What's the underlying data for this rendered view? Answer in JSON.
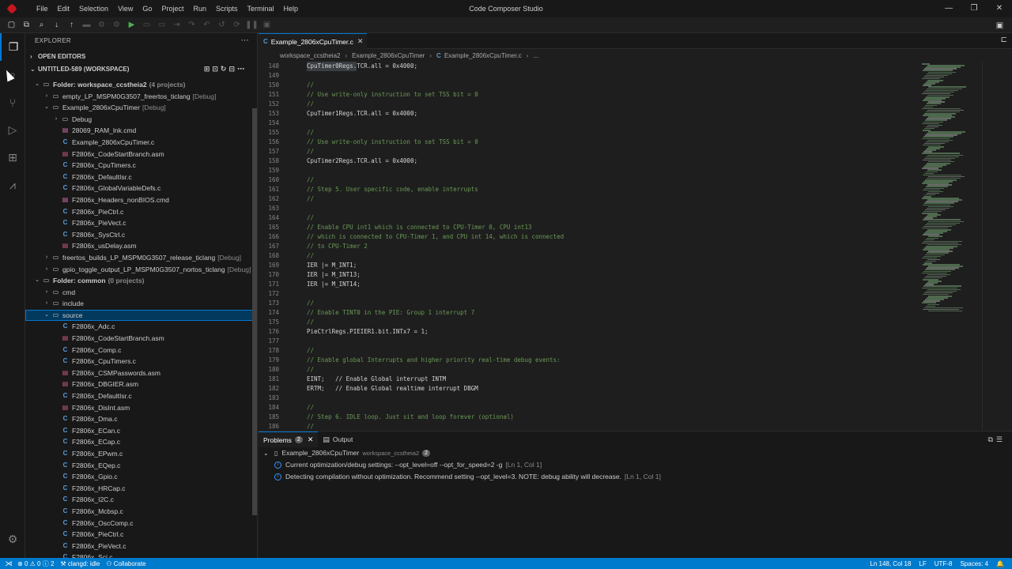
{
  "window": {
    "title": "Code Composer Studio",
    "menu": [
      "File",
      "Edit",
      "Selection",
      "View",
      "Go",
      "Project",
      "Run",
      "Scripts",
      "Terminal",
      "Help"
    ],
    "controls": [
      "—",
      "❐",
      "✕"
    ]
  },
  "explorer": {
    "title": "EXPLORER",
    "open_editors": "OPEN EDITORS",
    "workspace": "UNTITLED-589 (WORKSPACE)",
    "tree": [
      {
        "indent": 1,
        "chev": "⌄",
        "icon": "folder",
        "label": "Folder: workspace_ccstheia2",
        "tag": "(4 projects)",
        "bold": true
      },
      {
        "indent": 2,
        "chev": "›",
        "icon": "folder",
        "label": "empty_LP_MSPM0G3507_freertos_ticlang",
        "tag": "[Debug]"
      },
      {
        "indent": 2,
        "chev": "⌄",
        "icon": "folder",
        "label": "Example_2806xCpuTimer",
        "tag": "[Debug]"
      },
      {
        "indent": 3,
        "chev": "›",
        "icon": "folder",
        "label": "Debug",
        "tag": ""
      },
      {
        "indent": 3,
        "chev": "",
        "icon": "cmd",
        "label": "28069_RAM_lnk.cmd",
        "tag": ""
      },
      {
        "indent": 3,
        "chev": "",
        "icon": "c",
        "label": "Example_2806xCpuTimer.c",
        "tag": ""
      },
      {
        "indent": 3,
        "chev": "",
        "icon": "asm",
        "label": "F2806x_CodeStartBranch.asm",
        "tag": ""
      },
      {
        "indent": 3,
        "chev": "",
        "icon": "c",
        "label": "F2806x_CpuTimers.c",
        "tag": ""
      },
      {
        "indent": 3,
        "chev": "",
        "icon": "c",
        "label": "F2806x_DefaultIsr.c",
        "tag": ""
      },
      {
        "indent": 3,
        "chev": "",
        "icon": "c",
        "label": "F2806x_GlobalVariableDefs.c",
        "tag": ""
      },
      {
        "indent": 3,
        "chev": "",
        "icon": "cmd",
        "label": "F2806x_Headers_nonBIOS.cmd",
        "tag": ""
      },
      {
        "indent": 3,
        "chev": "",
        "icon": "c",
        "label": "F2806x_PieCtrl.c",
        "tag": ""
      },
      {
        "indent": 3,
        "chev": "",
        "icon": "c",
        "label": "F2806x_PieVect.c",
        "tag": ""
      },
      {
        "indent": 3,
        "chev": "",
        "icon": "c",
        "label": "F2806x_SysCtrl.c",
        "tag": ""
      },
      {
        "indent": 3,
        "chev": "",
        "icon": "asm",
        "label": "F2806x_usDelay.asm",
        "tag": ""
      },
      {
        "indent": 2,
        "chev": "›",
        "icon": "folder",
        "label": "freertos_builds_LP_MSPM0G3507_release_ticlang",
        "tag": "[Debug]"
      },
      {
        "indent": 2,
        "chev": "›",
        "icon": "folder",
        "label": "gpio_toggle_output_LP_MSPM0G3507_nortos_ticlang",
        "tag": "[Debug]"
      },
      {
        "indent": 1,
        "chev": "⌄",
        "icon": "folder",
        "label": "Folder: common",
        "tag": "(0 projects)",
        "bold": true
      },
      {
        "indent": 2,
        "chev": "›",
        "icon": "folder",
        "label": "cmd",
        "tag": ""
      },
      {
        "indent": 2,
        "chev": "›",
        "icon": "folder",
        "label": "include",
        "tag": ""
      },
      {
        "indent": 2,
        "chev": "⌄",
        "icon": "folder",
        "label": "source",
        "tag": "",
        "selected": true
      },
      {
        "indent": 3,
        "chev": "",
        "icon": "c",
        "label": "F2806x_Adc.c",
        "tag": ""
      },
      {
        "indent": 3,
        "chev": "",
        "icon": "asm",
        "label": "F2806x_CodeStartBranch.asm",
        "tag": ""
      },
      {
        "indent": 3,
        "chev": "",
        "icon": "c",
        "label": "F2806x_Comp.c",
        "tag": ""
      },
      {
        "indent": 3,
        "chev": "",
        "icon": "c",
        "label": "F2806x_CpuTimers.c",
        "tag": ""
      },
      {
        "indent": 3,
        "chev": "",
        "icon": "asm",
        "label": "F2806x_CSMPasswords.asm",
        "tag": ""
      },
      {
        "indent": 3,
        "chev": "",
        "icon": "asm",
        "label": "F2806x_DBGIER.asm",
        "tag": ""
      },
      {
        "indent": 3,
        "chev": "",
        "icon": "c",
        "label": "F2806x_DefaultIsr.c",
        "tag": ""
      },
      {
        "indent": 3,
        "chev": "",
        "icon": "asm",
        "label": "F2806x_DisInt.asm",
        "tag": ""
      },
      {
        "indent": 3,
        "chev": "",
        "icon": "c",
        "label": "F2806x_Dma.c",
        "tag": ""
      },
      {
        "indent": 3,
        "chev": "",
        "icon": "c",
        "label": "F2806x_ECan.c",
        "tag": ""
      },
      {
        "indent": 3,
        "chev": "",
        "icon": "c",
        "label": "F2806x_ECap.c",
        "tag": ""
      },
      {
        "indent": 3,
        "chev": "",
        "icon": "c",
        "label": "F2806x_EPwm.c",
        "tag": ""
      },
      {
        "indent": 3,
        "chev": "",
        "icon": "c",
        "label": "F2806x_EQep.c",
        "tag": ""
      },
      {
        "indent": 3,
        "chev": "",
        "icon": "c",
        "label": "F2806x_Gpio.c",
        "tag": ""
      },
      {
        "indent": 3,
        "chev": "",
        "icon": "c",
        "label": "F2806x_HRCap.c",
        "tag": ""
      },
      {
        "indent": 3,
        "chev": "",
        "icon": "c",
        "label": "F2806x_I2C.c",
        "tag": ""
      },
      {
        "indent": 3,
        "chev": "",
        "icon": "c",
        "label": "F2806x_Mcbsp.c",
        "tag": ""
      },
      {
        "indent": 3,
        "chev": "",
        "icon": "c",
        "label": "F2806x_OscComp.c",
        "tag": ""
      },
      {
        "indent": 3,
        "chev": "",
        "icon": "c",
        "label": "F2806x_PieCtrl.c",
        "tag": ""
      },
      {
        "indent": 3,
        "chev": "",
        "icon": "c",
        "label": "F2806x_PieVect.c",
        "tag": ""
      },
      {
        "indent": 3,
        "chev": "",
        "icon": "c",
        "label": "F2806x_Sci.c",
        "tag": ""
      }
    ]
  },
  "editor": {
    "tab": "Example_2806xCpuTimer.c",
    "breadcrumb": [
      "workspace_ccstheia2",
      "Example_2806xCpuTimer",
      "Example_2806xCpuTimer.c",
      "..."
    ],
    "lines": [
      {
        "n": 148,
        "t": "CpuTimer0Regs.TCR.all = 0x4000;",
        "hl": true
      },
      {
        "n": 149,
        "t": ""
      },
      {
        "n": 150,
        "t": "//",
        "cm": true
      },
      {
        "n": 151,
        "t": "// Use write-only instruction to set TSS bit = 0",
        "cm": true
      },
      {
        "n": 152,
        "t": "//",
        "cm": true
      },
      {
        "n": 153,
        "t": "CpuTimer1Regs.TCR.all = 0x4000;"
      },
      {
        "n": 154,
        "t": ""
      },
      {
        "n": 155,
        "t": "//",
        "cm": true
      },
      {
        "n": 156,
        "t": "// Use write-only instruction to set TSS bit = 0",
        "cm": true
      },
      {
        "n": 157,
        "t": "//",
        "cm": true
      },
      {
        "n": 158,
        "t": "CpuTimer2Regs.TCR.all = 0x4000;"
      },
      {
        "n": 159,
        "t": ""
      },
      {
        "n": 160,
        "t": "//",
        "cm": true
      },
      {
        "n": 161,
        "t": "// Step 5. User specific code, enable interrupts",
        "cm": true
      },
      {
        "n": 162,
        "t": "//",
        "cm": true
      },
      {
        "n": 163,
        "t": ""
      },
      {
        "n": 164,
        "t": "//",
        "cm": true
      },
      {
        "n": 165,
        "t": "// Enable CPU int1 which is connected to CPU-Timer 0, CPU int13",
        "cm": true
      },
      {
        "n": 166,
        "t": "// which is connected to CPU-Timer 1, and CPU int 14, which is connected",
        "cm": true
      },
      {
        "n": 167,
        "t": "// to CPU-Timer 2",
        "cm": true
      },
      {
        "n": 168,
        "t": "//",
        "cm": true
      },
      {
        "n": 169,
        "t": "IER |= M_INT1;"
      },
      {
        "n": 170,
        "t": "IER |= M_INT13;"
      },
      {
        "n": 171,
        "t": "IER |= M_INT14;"
      },
      {
        "n": 172,
        "t": ""
      },
      {
        "n": 173,
        "t": "//",
        "cm": true
      },
      {
        "n": 174,
        "t": "// Enable TINT0 in the PIE: Group 1 interrupt 7",
        "cm": true
      },
      {
        "n": 175,
        "t": "//",
        "cm": true
      },
      {
        "n": 176,
        "t": "PieCtrlRegs.PIEIER1.bit.INTx7 = 1;"
      },
      {
        "n": 177,
        "t": ""
      },
      {
        "n": 178,
        "t": "//",
        "cm": true
      },
      {
        "n": 179,
        "t": "// Enable global Interrupts and higher priority real-time debug events:",
        "cm": true
      },
      {
        "n": 180,
        "t": "//",
        "cm": true
      },
      {
        "n": 181,
        "t": "EINT;   // Enable Global interrupt INTM"
      },
      {
        "n": 182,
        "t": "ERTM;   // Enable Global realtime interrupt DBGM"
      },
      {
        "n": 183,
        "t": ""
      },
      {
        "n": 184,
        "t": "//",
        "cm": true
      },
      {
        "n": 185,
        "t": "// Step 6. IDLE loop. Just sit and loop forever (optional)",
        "cm": true
      },
      {
        "n": 186,
        "t": "//",
        "cm": true
      }
    ]
  },
  "panel": {
    "problems_label": "Problems",
    "problems_count": "2",
    "output_label": "Output",
    "group_file": "Example_2806xCpuTimer",
    "group_folder": "workspace_ccstheia2",
    "group_count": "2",
    "messages": [
      {
        "text": "Current optimization/debug settings: --opt_level=off --opt_for_speed=2 -g",
        "loc": "[Ln 1, Col 1]"
      },
      {
        "text": "Detecting compilation without optimization. Recommend setting --opt_level=3. NOTE: debug ability will decrease.",
        "loc": "[Ln 1, Col 1]"
      }
    ]
  },
  "statusbar": {
    "errors": "0",
    "warnings": "0",
    "infos": "2",
    "clangd": "clangd: idle",
    "collaborate": "Collaborate",
    "position": "Ln 148, Col 18",
    "eol": "LF",
    "encoding": "UTF-8",
    "spaces": "Spaces: 4"
  },
  "colors": {
    "accent": "#0078d4",
    "statusbar": "#007acc",
    "comment": "#6a9955"
  }
}
